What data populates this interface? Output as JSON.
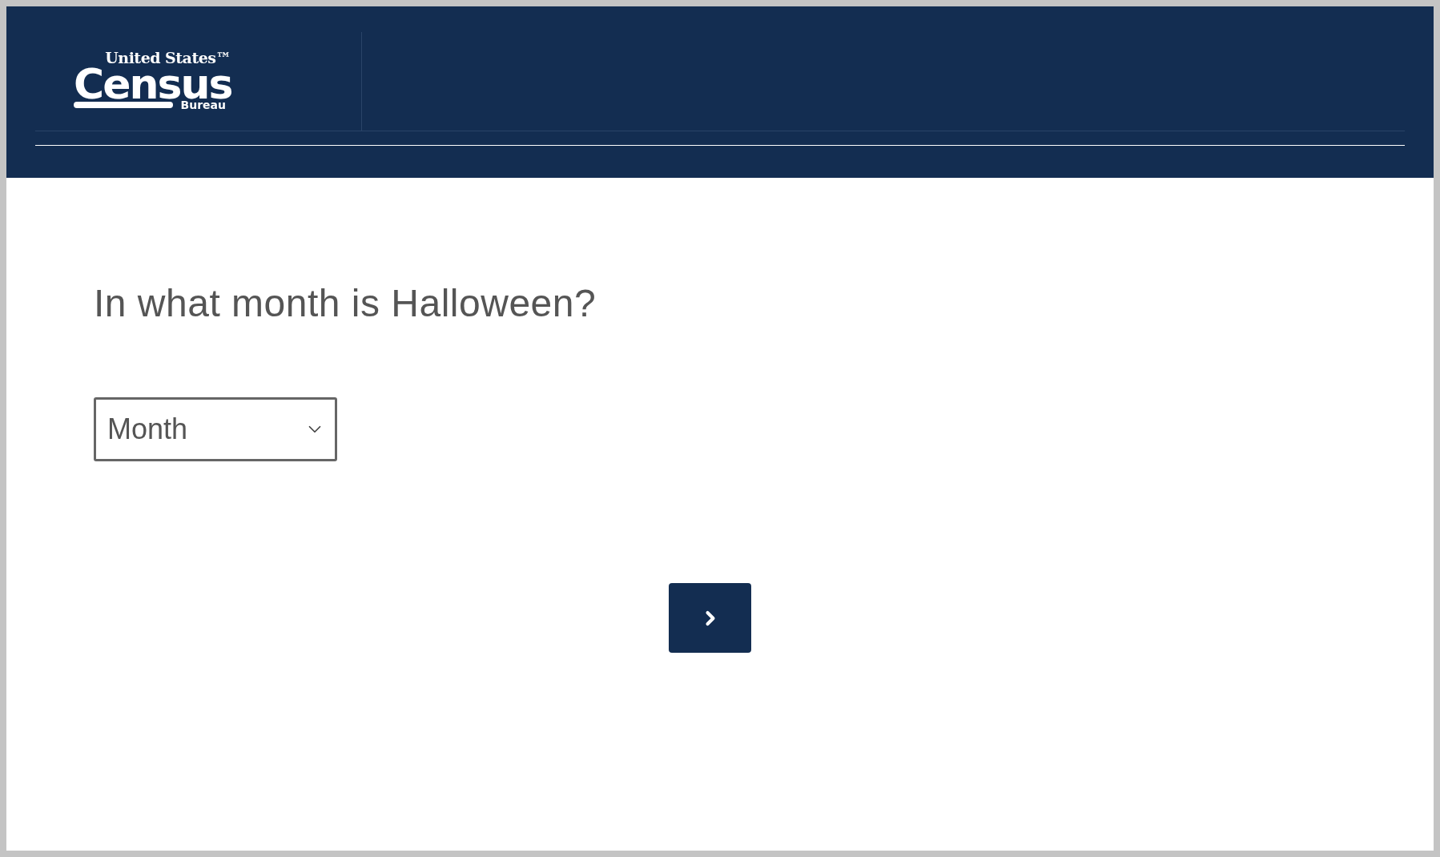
{
  "header": {
    "logo": {
      "top": "United States™",
      "main": "Census",
      "bottom": "Bureau"
    }
  },
  "question": "In what month is Halloween?",
  "month_select": {
    "placeholder": "Month"
  }
}
